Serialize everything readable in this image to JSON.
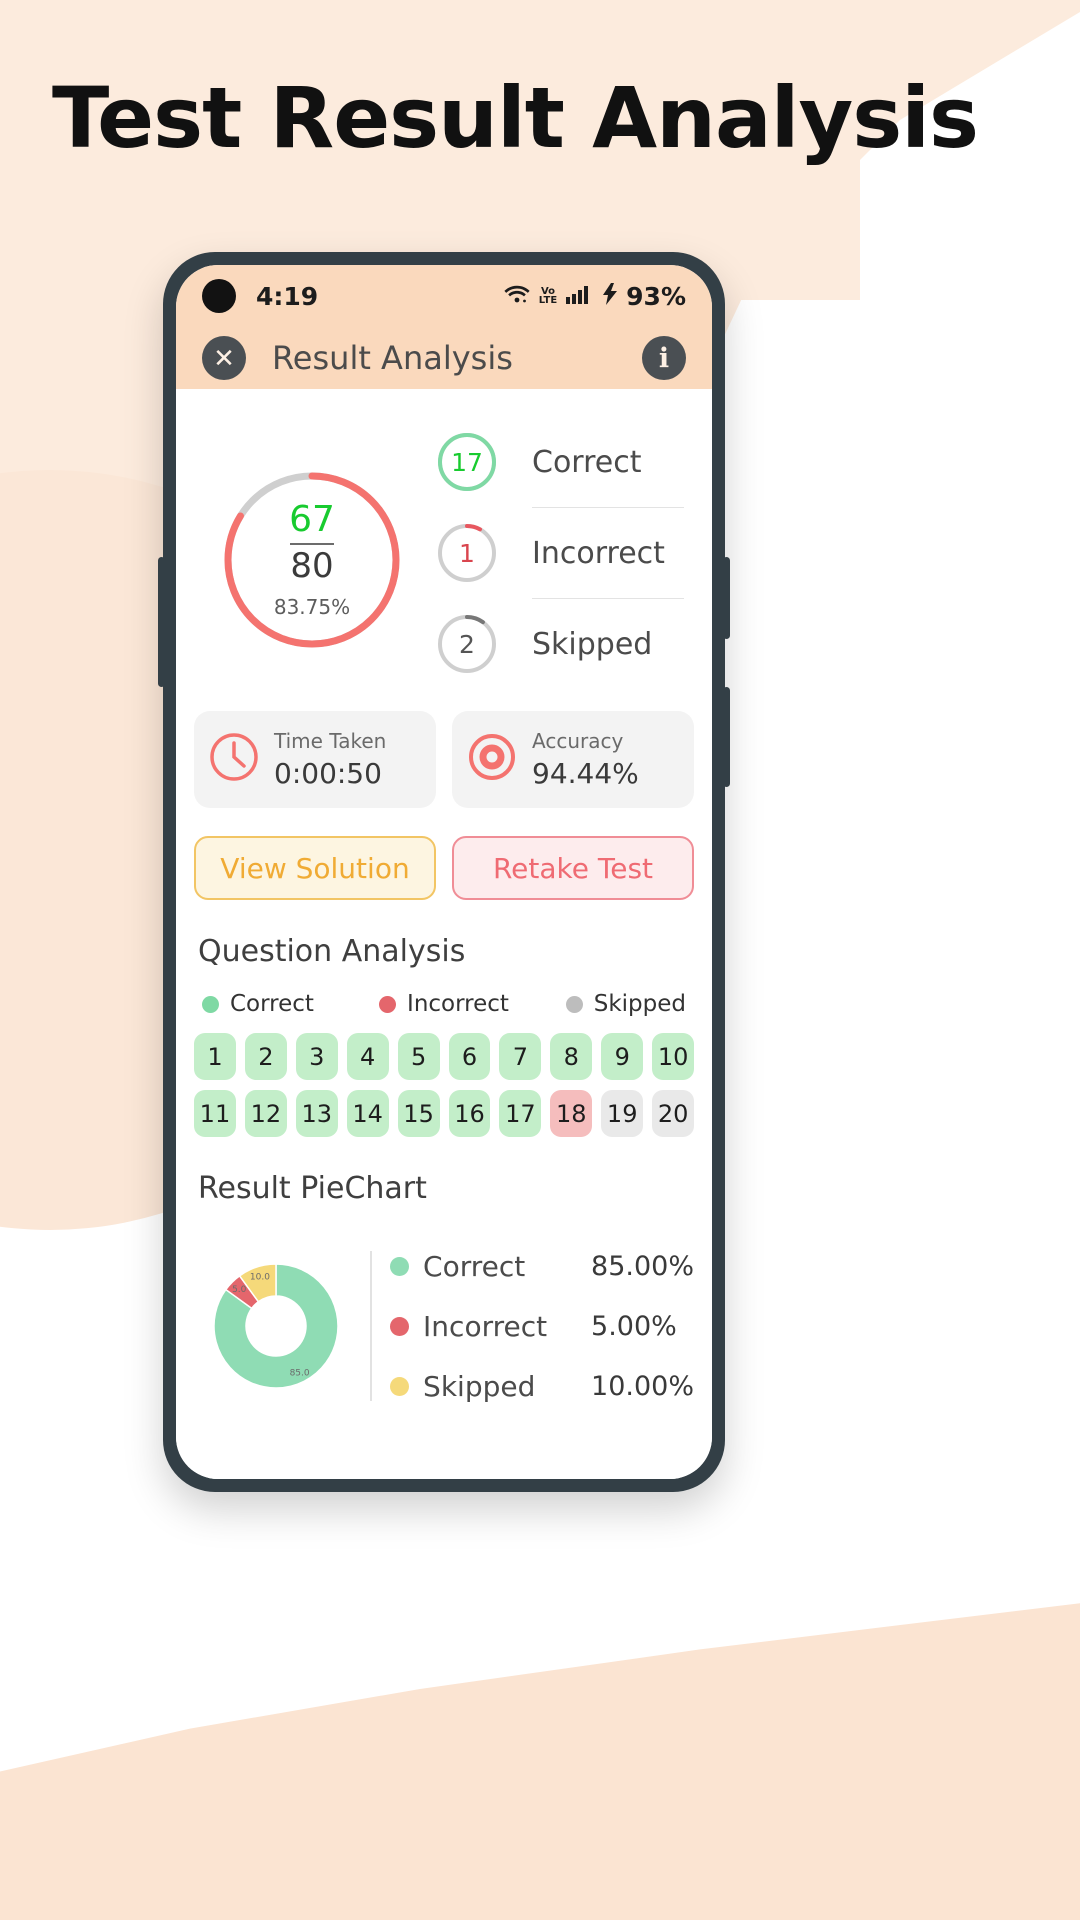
{
  "page": {
    "title": "Test Result Analysis"
  },
  "statusbar": {
    "time": "4:19",
    "wifi_icon": "wifi-icon",
    "volte_top": "Vo",
    "volte_bottom": "LTE",
    "signal_icon": "cellular-signal-icon",
    "charging_icon": "charging-bolt-icon",
    "battery": "93%"
  },
  "appbar": {
    "close_label": "✕",
    "title": "Result Analysis",
    "info_label": "i"
  },
  "score": {
    "obtained": "67",
    "total": "80",
    "percent": "83.75%",
    "ring_percent": 83.75,
    "ring_color": "#f4736f",
    "ring_track": "#cfcfcf",
    "obtained_color": "#18cb2f"
  },
  "stats": [
    {
      "count": "17",
      "label": "Correct",
      "color": "#7fd9a4",
      "fill": 100,
      "track": "#cfcfcf"
    },
    {
      "count": "1",
      "label": "Incorrect",
      "color": "#e8575f",
      "fill": 8,
      "track": "#cfcfcf"
    },
    {
      "count": "2",
      "label": "Skipped",
      "color": "#777777",
      "fill": 10,
      "track": "#cfcfcf"
    }
  ],
  "cards": [
    {
      "icon": "clock-icon",
      "title": "Time Taken",
      "value": "0:00:50"
    },
    {
      "icon": "target-icon",
      "title": "Accuracy",
      "value": "94.44%"
    }
  ],
  "actions": {
    "view_solution": "View Solution",
    "retake_test": "Retake Test"
  },
  "question_analysis": {
    "title": "Question Analysis",
    "legend": [
      {
        "label": "Correct",
        "color": "#7fd9a4"
      },
      {
        "label": "Incorrect",
        "color": "#e4666c"
      },
      {
        "label": "Skipped",
        "color": "#bdbdbd"
      }
    ],
    "rows": [
      [
        {
          "n": "1",
          "state": "correct"
        },
        {
          "n": "2",
          "state": "correct"
        },
        {
          "n": "3",
          "state": "correct"
        },
        {
          "n": "4",
          "state": "correct"
        },
        {
          "n": "5",
          "state": "correct"
        },
        {
          "n": "6",
          "state": "correct"
        },
        {
          "n": "7",
          "state": "correct"
        },
        {
          "n": "8",
          "state": "correct"
        },
        {
          "n": "9",
          "state": "correct"
        },
        {
          "n": "10",
          "state": "correct"
        }
      ],
      [
        {
          "n": "11",
          "state": "correct"
        },
        {
          "n": "12",
          "state": "correct"
        },
        {
          "n": "13",
          "state": "correct"
        },
        {
          "n": "14",
          "state": "correct"
        },
        {
          "n": "15",
          "state": "correct"
        },
        {
          "n": "16",
          "state": "correct"
        },
        {
          "n": "17",
          "state": "correct"
        },
        {
          "n": "18",
          "state": "incorrect"
        },
        {
          "n": "19",
          "state": "skipped"
        },
        {
          "n": "20",
          "state": "skipped"
        }
      ]
    ]
  },
  "piechart_section": {
    "title": "Result PieChart"
  },
  "chart_data": {
    "type": "pie",
    "title": "Result PieChart",
    "labels": [
      "Correct",
      "Incorrect",
      "Skipped"
    ],
    "values": [
      85.0,
      5.0,
      10.0
    ],
    "display_values": [
      "85.00%",
      "5.00%",
      "10.00%"
    ],
    "slice_labels": [
      "85.0",
      "5.0",
      "10.0"
    ],
    "colors": [
      "#8fdcb4",
      "#e4666c",
      "#f5d97a"
    ],
    "legend_position": "right",
    "donut": true,
    "grid": false
  }
}
